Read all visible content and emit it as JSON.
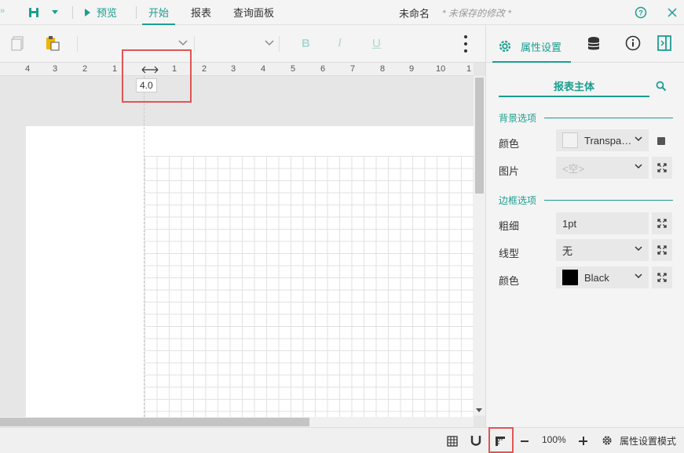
{
  "topbar": {
    "preview_label": "预览",
    "tabs": [
      "开始",
      "报表",
      "查询面板"
    ],
    "doc_title": "未命名",
    "unsaved_note": "* 未保存的修改 *"
  },
  "ruler": {
    "ticks_left": [
      "4",
      "3",
      "2",
      "1"
    ],
    "ticks_right": [
      "1",
      "2",
      "3",
      "4",
      "5",
      "6",
      "7",
      "8",
      "9",
      "10",
      "1"
    ],
    "tooltip_value": "4.0"
  },
  "panel": {
    "active_tab_label": "属性设置",
    "subject_label": "报表主体",
    "background_section": "背景选项",
    "border_section": "边框选项",
    "props": {
      "bg_color_label": "颜色",
      "bg_color_value": "Transpa…",
      "bg_image_label": "图片",
      "bg_image_value": "<空>",
      "border_width_label": "粗细",
      "border_width_value": "1pt",
      "border_style_label": "线型",
      "border_style_value": "无",
      "border_color_label": "颜色",
      "border_color_value": "Black"
    }
  },
  "statusbar": {
    "zoom": "100%",
    "mode_label": "属性设置模式"
  },
  "colors": {
    "accent": "#1a9e8f",
    "highlight": "#e05555"
  }
}
